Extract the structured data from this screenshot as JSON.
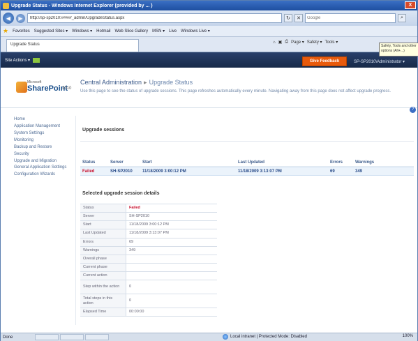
{
  "window": {
    "title": "Upgrade Status - Windows Internet Explorer (provided by ... )",
    "close": "X"
  },
  "address_bar": {
    "url": "http://sp-sp2010:####/_admin/UpgradeStatus.aspx",
    "search_placeholder": "Google"
  },
  "favorites_bar": {
    "label": "Favorites",
    "items": [
      "Suggested Sites ▾",
      "Windows ▾",
      "Hotmail",
      "Web Slice Gallery",
      "MSN ▾",
      "Live",
      "Windows Live ▾"
    ]
  },
  "tab": {
    "title": "Upgrade Status"
  },
  "command_bar": {
    "items": [
      "Page ▾",
      "Safety ▾",
      "Tools ▾"
    ]
  },
  "tooltip": {
    "text": "Safety, Tools and other options (Alt+...)"
  },
  "ribbon": {
    "site_actions": "Site Actions ▾",
    "feedback_button": "Give Feedback",
    "user": "SP-SP2010\\Administrator ▾"
  },
  "header": {
    "logo_brand": "Microsoft",
    "logo_text": "SharePoint",
    "logo_year": "2010",
    "breadcrumb_root": "Central Administration",
    "breadcrumb_sep": "▸",
    "breadcrumb_current": "Upgrade Status",
    "description": "Use this page to see the status of upgrade sessions. This page refreshes automatically every minute. Navigating away from this page does not affect upgrade progress."
  },
  "left_nav": [
    "Home",
    "Application Management",
    "System Settings",
    "Monitoring",
    "Backup and Restore",
    "Security",
    "Upgrade and Migration",
    "General Application Settings",
    "Configuration Wizards"
  ],
  "sessions": {
    "title": "Upgrade sessions",
    "columns": [
      "Status",
      "Server",
      "Start",
      "Last Updated",
      "Errors",
      "Warnings"
    ],
    "rows": [
      {
        "status": "Failed",
        "server": "SH-SP2010",
        "start": "11/18/2009 3:00:12 PM",
        "last_updated": "11/18/2009 3:13:07 PM",
        "errors": "69",
        "warnings": "349"
      }
    ]
  },
  "details": {
    "title": "Selected upgrade session details",
    "rows": [
      {
        "label": "Status",
        "value": "Failed"
      },
      {
        "label": "Server",
        "value": "SH-SP2010"
      },
      {
        "label": "Start",
        "value": "11/18/2009 3:00:12 PM"
      },
      {
        "label": "Last Updated",
        "value": "11/18/2009 3:13:07 PM"
      },
      {
        "label": "Errors",
        "value": "69"
      },
      {
        "label": "Warnings",
        "value": "349"
      },
      {
        "label": "Overall phase",
        "value": ""
      },
      {
        "label": "Current phase",
        "value": ""
      },
      {
        "label": "Current action",
        "value": ""
      },
      {
        "label": "Step within the action",
        "value": "0"
      },
      {
        "label": "Total steps in this action",
        "value": "0"
      },
      {
        "label": "Elapsed Time",
        "value": "00:00:00"
      }
    ]
  },
  "status_bar": {
    "left": "Done",
    "zone": "Local intranet | Protected Mode: Disabled",
    "zoom": "100%"
  }
}
